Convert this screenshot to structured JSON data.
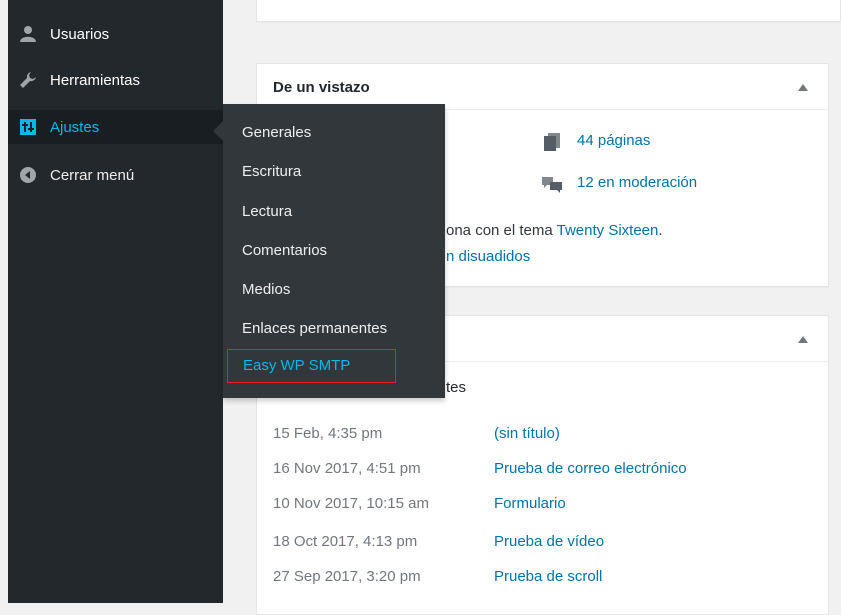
{
  "sidebar": {
    "items": [
      {
        "label": "Usuarios",
        "icon": "users-icon"
      },
      {
        "label": "Herramientas",
        "icon": "wrench-icon"
      },
      {
        "label": "Ajustes",
        "icon": "settings-icon",
        "current": true
      },
      {
        "label": "Cerrar menú",
        "icon": "collapse-icon"
      }
    ]
  },
  "submenu": {
    "items": [
      {
        "label": "Generales"
      },
      {
        "label": "Escritura"
      },
      {
        "label": "Lectura"
      },
      {
        "label": "Comentarios"
      },
      {
        "label": "Medios"
      },
      {
        "label": "Enlaces permanentes"
      },
      {
        "label": "Easy WP SMTP",
        "highlighted": true
      }
    ]
  },
  "glance": {
    "title": "De un vistazo",
    "pages": "44 páginas",
    "moderation": "12 en moderación",
    "theme_prefix": "ona con el tema ",
    "theme_name": "Twenty Sixteen",
    "theme_suffix": ".",
    "discouraged": "n disuadidos"
  },
  "activity": {
    "subtitle_fragment": "tes",
    "rows": [
      {
        "date": "15 Feb, 4:35 pm",
        "title": "(sin título)"
      },
      {
        "date": "16 Nov 2017, 4:51 pm",
        "title": "Prueba de correo electrónico"
      },
      {
        "date": "10 Nov 2017, 10:15 am",
        "title": "Formulario"
      },
      {
        "date": "18 Oct 2017, 4:13 pm",
        "title": "Prueba de vídeo"
      },
      {
        "date": "27 Sep 2017, 3:20 pm",
        "title": "Prueba de scroll"
      }
    ]
  },
  "colors": {
    "sidebar_bg": "#23282d",
    "submenu_bg": "#32373c",
    "accent": "#00b9eb",
    "link": "#0073aa",
    "highlight_border": "#e0232b"
  }
}
